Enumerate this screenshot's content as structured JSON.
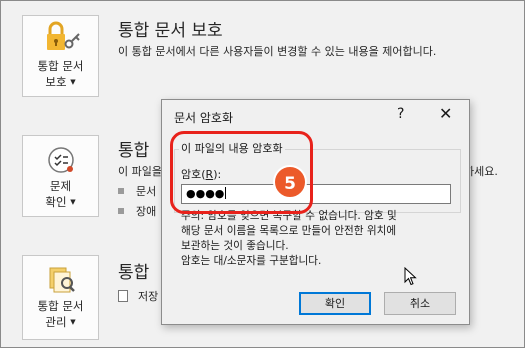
{
  "tiles": [
    {
      "line1": "통합 문서",
      "line2": "보호",
      "icon": "lock-icon"
    },
    {
      "line1": "문제",
      "line2": "확인",
      "icon": "inspect-icon"
    },
    {
      "line1": "통합 문서",
      "line2": "관리",
      "icon": "manage-icon"
    }
  ],
  "sections": {
    "protect_title": "통합 문서 보호",
    "protect_desc": "이 통합 문서에서 다른 사용자들이 변경할 수 있는 내용을 제어합니다.",
    "inspect_title": "통합",
    "inspect_desc": "이 파일을",
    "inspect_right": "하세요.",
    "bullet1": "문서",
    "bullet2": "장애",
    "manage_title": "통합",
    "manage_file": "저장"
  },
  "dialog": {
    "title": "문서 암호화",
    "help": "?",
    "close": "✕",
    "group_title": "이 파일의 내용 암호화",
    "password_label_prefix": "암호(",
    "password_label_key": "R",
    "password_label_suffix": "):",
    "password_value": "●●●●",
    "note_lines": [
      "주의: 암호를 잊으면 복구할 수 없습니다. 암호 및",
      "해당 문서 이름을 목록으로 만들어 안전한 위치에",
      "보관하는 것이 좋습니다.",
      "암호는 대/소문자를 구분합니다."
    ],
    "ok": "확인",
    "cancel": "취소"
  },
  "step_badge": "5",
  "colors": {
    "highlight": "#e8221b",
    "badge": "#ec5a2a",
    "accent": "#0078d7"
  }
}
